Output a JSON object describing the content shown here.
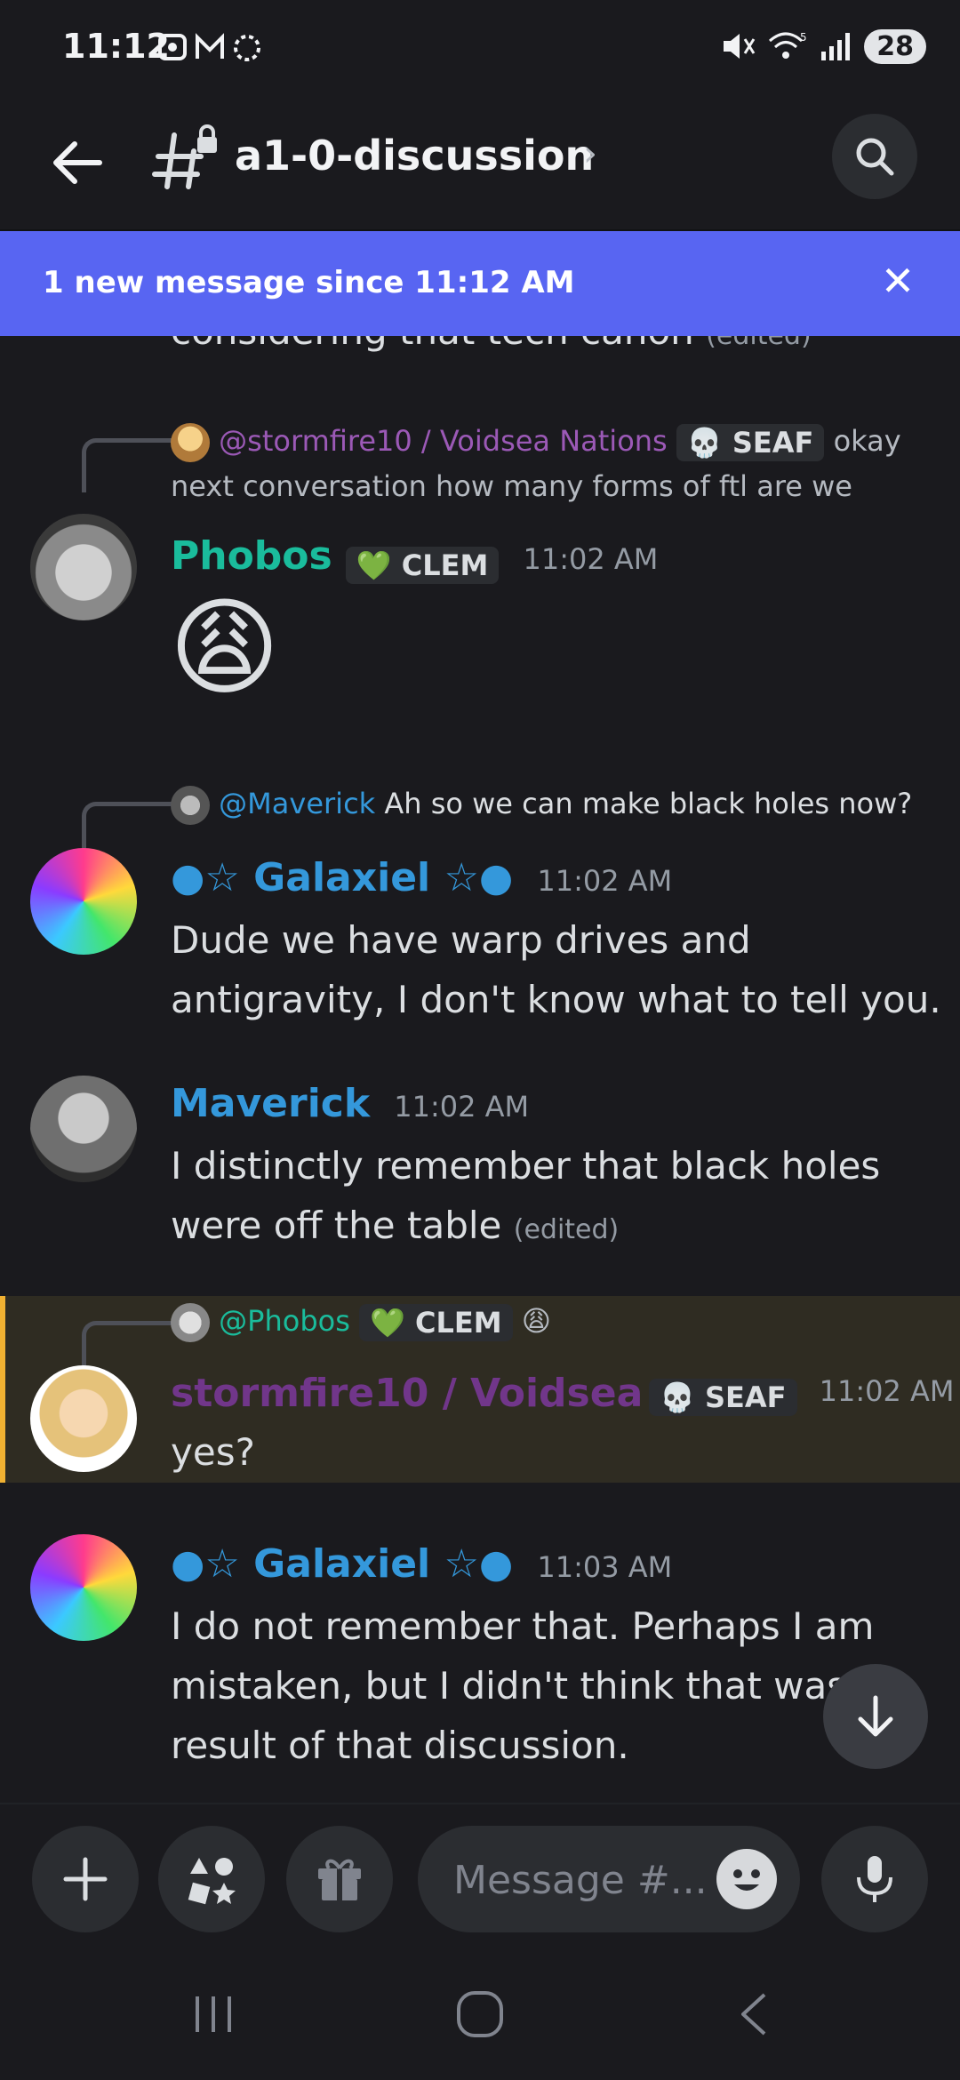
{
  "status": {
    "time": "11:12",
    "battery": "28"
  },
  "header": {
    "channel": "a1-0-discussion"
  },
  "banner": {
    "text": "1 new message since 11:12 AM"
  },
  "partial": {
    "text": "considering that tech canon",
    "edited": "(edited)"
  },
  "messages": [
    {
      "reply_to": "@stormfire10 / Voidsea Nations",
      "reply_tag": "SEAF",
      "reply_text_1": "okay",
      "reply_text_2": "next conversation how many forms of ftl are we",
      "author": "Phobos",
      "tag": "CLEM",
      "time": "11:02 AM",
      "emoji": "😩"
    },
    {
      "reply_to": "@Maverick",
      "reply_text": "Ah so we can make black holes now?",
      "author": "Galaxiel",
      "time": "11:02 AM",
      "line1": "Dude we have warp drives and",
      "line2": "antigravity, I don't know what to tell you."
    },
    {
      "author": "Maverick",
      "time": "11:02 AM",
      "line1": "I distinctly remember that black holes",
      "line2": "were off the table",
      "edited": "(edited)"
    },
    {
      "reply_to": "@Phobos",
      "reply_tag": "CLEM",
      "reply_emoji": "😩",
      "author": "stormfire10 / Voidsea ...",
      "tag": "SEAF",
      "time": "11:02 AM",
      "text": "yes?"
    },
    {
      "author": "Galaxiel",
      "time": "11:03 AM",
      "line1": "I do not remember that. Perhaps I am",
      "line2": "mistaken, but I didn't think that was t",
      "line3": "result of that discussion."
    }
  ],
  "composer": {
    "placeholder": "Message #..."
  },
  "colors": {
    "blurple": "#5865f2",
    "teal_name": "#1abc9c",
    "blue_name": "#3498db",
    "purple_name": "#71368a",
    "highlight_bar": "#f0b132"
  }
}
